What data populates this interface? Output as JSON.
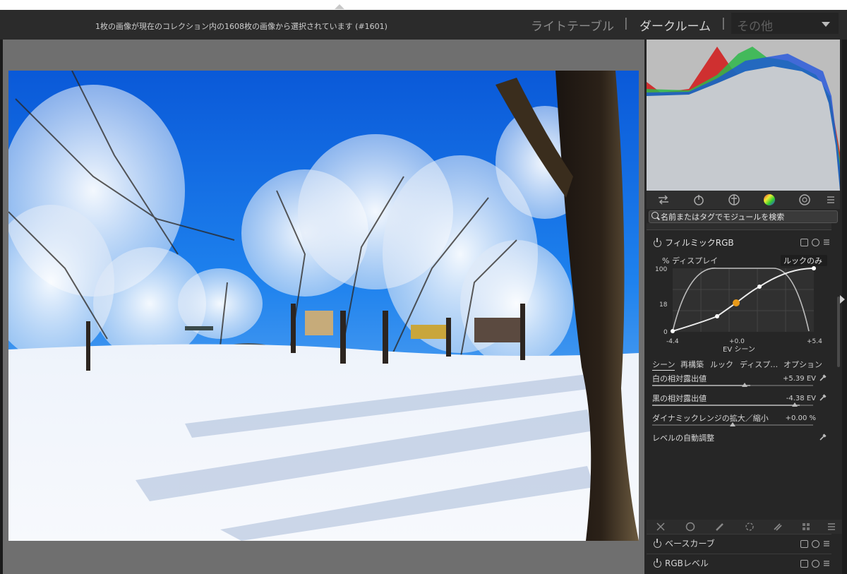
{
  "header": {
    "status_text": "1枚の画像が現在のコレクション内の1608枚の画像から選択されています (#1601)",
    "views": {
      "lighttable": "ライトテーブル",
      "darkroom": "ダークルーム",
      "other": "その他",
      "separator": "|"
    },
    "active_view": "darkroom"
  },
  "panel": {
    "search_placeholder": "名前またはタグでモジュールを検索",
    "tab_icons": [
      "quick-access-icon",
      "power-icon",
      "base-icon",
      "color-wheel-icon",
      "effect-icon",
      "menu-icon"
    ],
    "module": {
      "title": "フィルミックRGB",
      "graph": {
        "ylabel_left": "% ディスプレイ",
        "mode_label": "ルックのみ",
        "y_ticks": [
          "100",
          "18",
          "0"
        ],
        "x_ticks": [
          "-4.4",
          "+0.0",
          "+5.4"
        ],
        "x_title": "EV  シーン"
      },
      "subtabs": [
        "シーン",
        "再構築",
        "ルック",
        "ディスプ…",
        "オプション"
      ],
      "params": [
        {
          "label": "白の相対露出値",
          "value": "+5.39 EV",
          "position": 0.61
        },
        {
          "label": "黒の相対露出値",
          "value": "-4.38 EV",
          "position": 0.92
        },
        {
          "label": "ダイナミックレンジの拡大／縮小",
          "value": "+0.00 %",
          "position": 0.5
        },
        {
          "label": "レベルの自動調整",
          "value": "",
          "position": null
        }
      ]
    },
    "bottom_toolbar_icons": [
      "close-icon",
      "circle-icon",
      "brush-icon",
      "drawn-mask-icon",
      "parametric-icon",
      "raster-icon",
      "menu-icon"
    ],
    "collapsed_modules": [
      {
        "name": "ベースカーブ"
      },
      {
        "name": "RGBレベル"
      }
    ]
  },
  "colors": {
    "header_bg": "#2b2b2b",
    "panel_bg": "#262626",
    "center_bg": "#6f6f6f",
    "accent_point": "#e89a1a"
  }
}
